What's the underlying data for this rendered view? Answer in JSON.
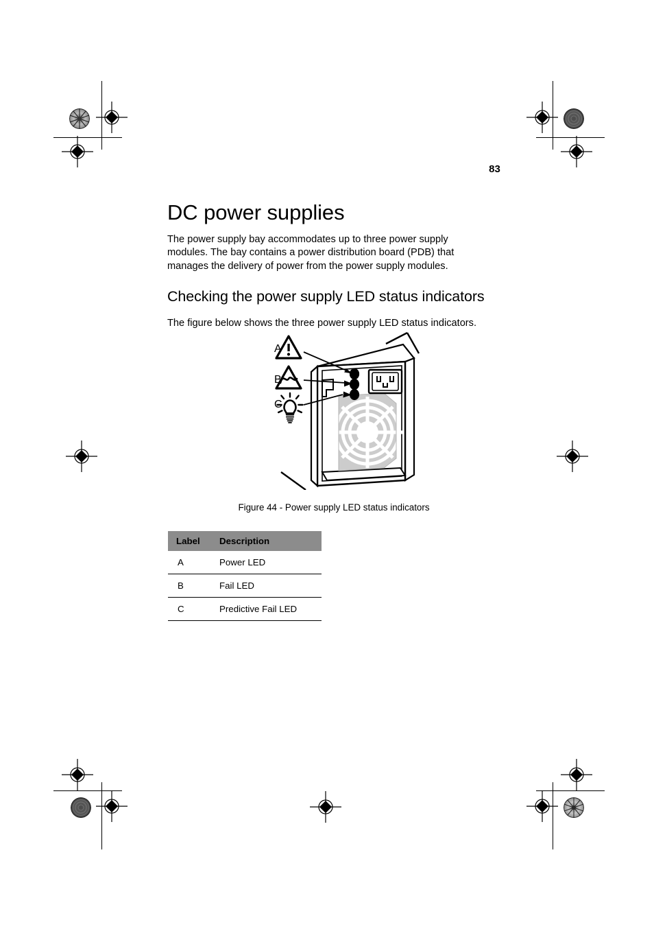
{
  "page": {
    "number": "83"
  },
  "heading": {
    "title": "DC power supplies",
    "subtitle": "Checking the power supply LED status indicators"
  },
  "paragraphs": {
    "intro": "The power supply bay accommodates up to three power supply modules.  The bay contains a power distribution board (PDB) that manages the delivery of power from the power supply modules.",
    "figure_lead": "The figure below shows the three power supply LED status indicators."
  },
  "figure": {
    "caption": "Figure 44 - Power supply LED status indicators",
    "callouts": [
      {
        "label": "A",
        "icon": "warning-triangle-exclamation-icon"
      },
      {
        "label": "B",
        "icon": "triangle-waveform-icon"
      },
      {
        "label": "C",
        "icon": "light-bulb-icon"
      }
    ]
  },
  "table": {
    "headers": [
      "Label",
      "Description"
    ],
    "rows": [
      {
        "label": "A",
        "description": "Power LED"
      },
      {
        "label": "B",
        "description": "Fail LED"
      },
      {
        "label": "C",
        "description": "Predictive Fail LED"
      }
    ]
  },
  "colors": {
    "table_header_bg": "#8c8c8c",
    "fan_grille_fill": "#cccccc",
    "text": "#000000",
    "page_bg": "#ffffff"
  }
}
